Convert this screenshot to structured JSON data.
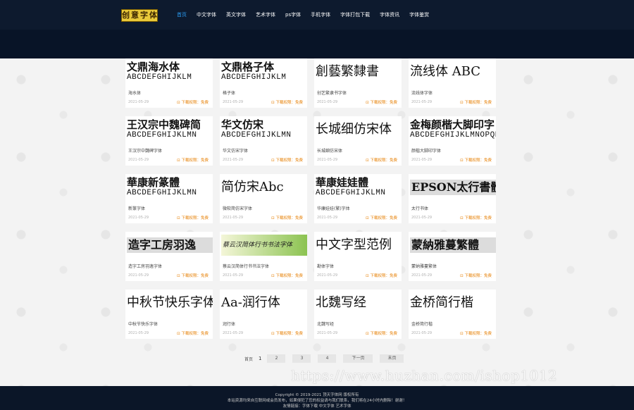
{
  "header": {
    "logo_text": "创意字体",
    "nav": [
      {
        "label": "首页",
        "active": true
      },
      {
        "label": "中文字体",
        "active": false
      },
      {
        "label": "英文字体",
        "active": false
      },
      {
        "label": "艺术字体",
        "active": false
      },
      {
        "label": "ps字体",
        "active": false
      },
      {
        "label": "手机字体",
        "active": false
      },
      {
        "label": "字体打包下载",
        "active": false
      },
      {
        "label": "字体资讯",
        "active": false
      },
      {
        "label": "字体鉴赏",
        "active": false
      }
    ]
  },
  "cards": [
    {
      "preview_cn": "文鼎海水体",
      "preview_en": "ABCDEFGHIJKLM",
      "name": "海水体",
      "date": "2021-05-29",
      "download": "下载权限：免费"
    },
    {
      "preview_cn": "文鼎格子体",
      "preview_en": "ABCDEFGHIJKLM",
      "name": "格子体",
      "date": "2021-05-29",
      "download": "下载权限：免费"
    },
    {
      "preview_cn": "",
      "preview_en": "",
      "preview_single": "創藝繁隸書",
      "name": "创艺繁隶书字体",
      "date": "2021-05-29",
      "download": "下载权限：免费"
    },
    {
      "preview_cn": "",
      "preview_en": "",
      "preview_single": "流线体 ABC",
      "name": "流线体字体",
      "date": "2021-05-29",
      "download": "下载权限：免费"
    },
    {
      "preview_cn": "王汉宗中魏碑简",
      "preview_en": "ABCDEFGHIJKLMN",
      "name": "王汉宗中魏碑字体",
      "date": "2021-05-29",
      "download": "下载权限：免费"
    },
    {
      "preview_cn": "华文仿宋",
      "preview_en": "ABCDEFGHIJKLMN",
      "name": "华文仿宋字体",
      "date": "2021-05-29",
      "download": "下载权限：免费"
    },
    {
      "preview_cn": "",
      "preview_en": "",
      "preview_single": "长城细仿宋体",
      "name": "长城细仿宋体",
      "date": "2021-05-29",
      "download": "下载权限：免费"
    },
    {
      "preview_cn": "金梅颜楷大脚印字",
      "preview_en": "ABCDEFGHIJKLMNOPQRS",
      "name": "颜楷大脚印字体",
      "date": "2021-05-29",
      "download": "下载权限：免费"
    },
    {
      "preview_cn": "華康新篆體",
      "preview_en": "ABCDEFGHIJKLMN",
      "name": "新篆字体",
      "date": "2021-05-29",
      "download": "下载权限：免费"
    },
    {
      "preview_cn": "",
      "preview_en": "",
      "preview_single": "简仿宋Abc",
      "name": "微软简仿宋字体",
      "date": "2021-05-29",
      "download": "下载权限：免费"
    },
    {
      "preview_cn": "華康娃娃體",
      "preview_en": "ABCDEFGHIJKLMN",
      "name": "华康娃娃(繁)字体",
      "date": "2021-05-29",
      "download": "下载权限：免费"
    },
    {
      "preview_cn": "",
      "preview_en": "",
      "preview_single": "EPSON太行書體",
      "boxed": true,
      "name": "太行书体",
      "date": "2021-05-29",
      "download": "下载权限：免费"
    },
    {
      "preview_cn": "",
      "preview_en": "",
      "preview_single": "造字工房羽逸",
      "boxed": true,
      "name": "造字工房羽逸字体",
      "date": "2021-05-29",
      "download": "下载权限：免费"
    },
    {
      "preview_cn": "",
      "preview_en": "",
      "preview_single": "蔡云汉简体行书书法字体",
      "green": true,
      "name": "蔡云汉简体行书书法字体",
      "date": "2021-05-29",
      "download": "下载权限：免费"
    },
    {
      "preview_cn": "",
      "preview_en": "",
      "preview_single": "中文字型范例",
      "name": "勘体字体",
      "date": "2021-05-29",
      "download": "下载权限：免费"
    },
    {
      "preview_cn": "",
      "preview_en": "",
      "preview_single": "蒙納雅蔓繁體",
      "boxed": true,
      "name": "蒙纳雅蔓繁体",
      "date": "2021-05-29",
      "download": "下载权限：免费"
    },
    {
      "preview_cn": "",
      "preview_en": "",
      "preview_single": "中秋节快乐字体",
      "name": "中秋节快乐字体",
      "date": "2021-05-29",
      "download": "下载权限：免费"
    },
    {
      "preview_cn": "",
      "preview_en": "",
      "preview_single": "Aa-润行体",
      "name": "润行体",
      "date": "2021-05-29",
      "download": "下载权限：免费"
    },
    {
      "preview_cn": "",
      "preview_en": "",
      "preview_single": "北魏写经",
      "name": "北魏写经",
      "date": "2021-05-29",
      "download": "下载权限：免费"
    },
    {
      "preview_cn": "",
      "preview_en": "",
      "preview_single": "金桥简行楷",
      "name": "金桥简行楷",
      "date": "2021-05-29",
      "download": "下载权限：免费"
    }
  ],
  "pagination": {
    "first_label": "首页",
    "current": "1",
    "pages": [
      "2",
      "3",
      "4"
    ],
    "next_label": "下一页",
    "last_label": "末页"
  },
  "watermark": "https://www.huzhan.com/ishop1012",
  "footer": {
    "copyright": "Copyright © 2019-2021 顶天字体网 版权所有",
    "notice": "本站资源均来自互联网或会员发布，如果侵犯了您的权益请与我们联系，我们将在24小时内删除！谢谢！",
    "links": "友情链接：字体下载 中文字体 艺术字体"
  }
}
